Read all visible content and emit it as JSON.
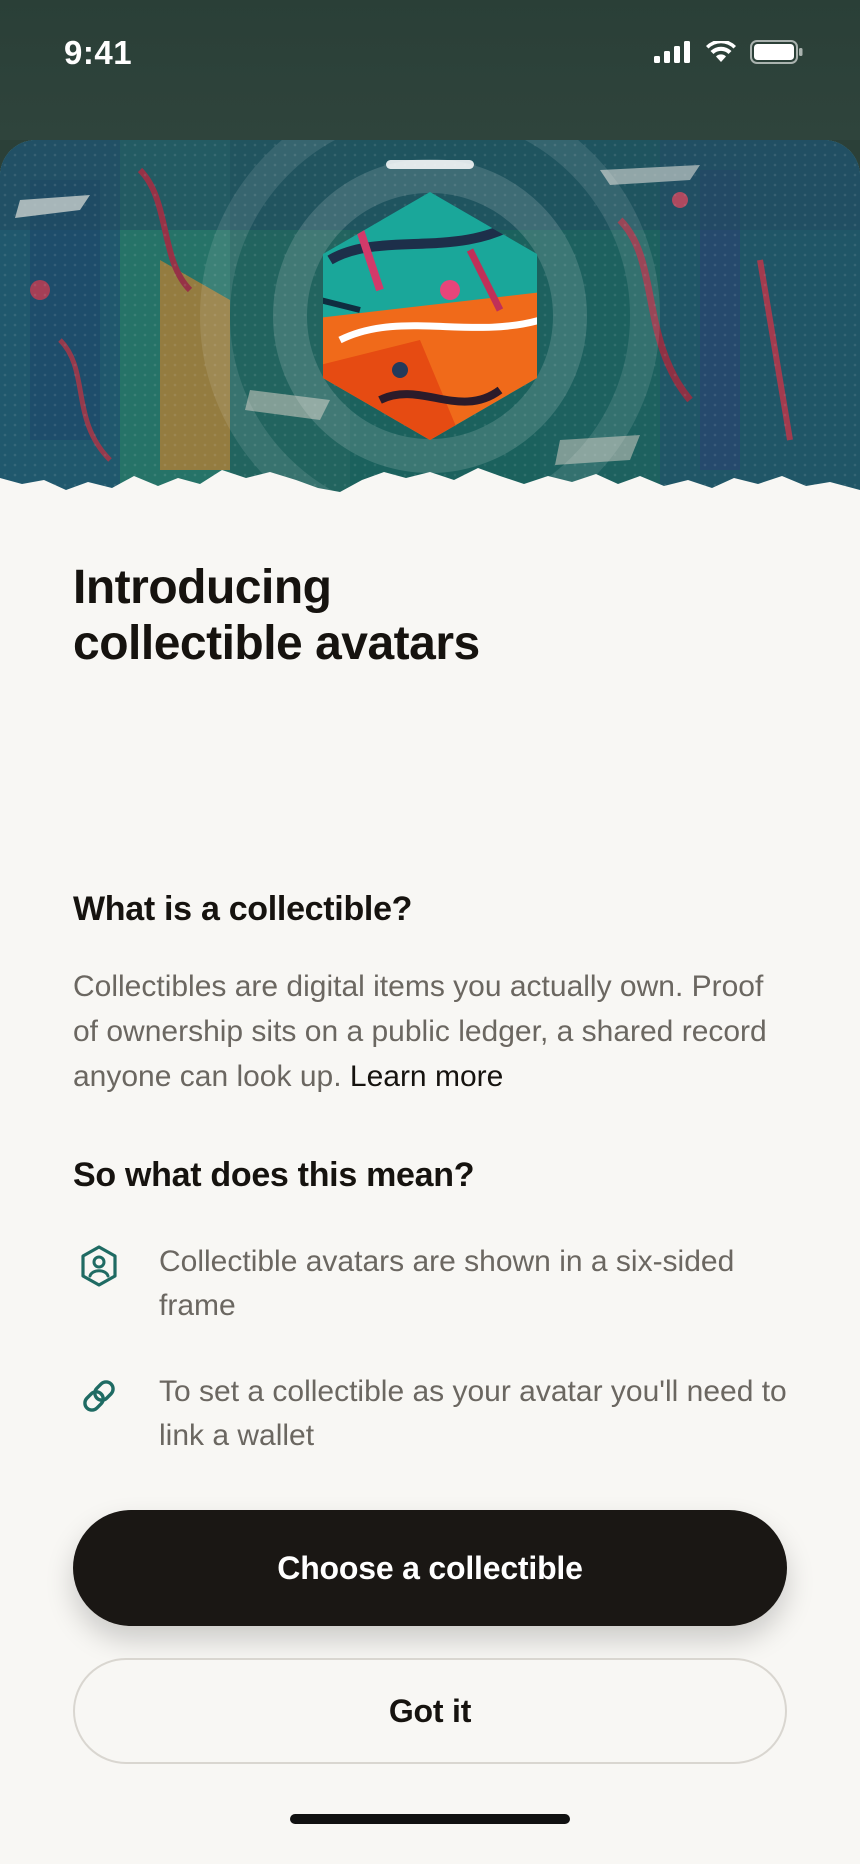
{
  "status": {
    "time": "9:41"
  },
  "sheet": {
    "title_line1": "Introducing",
    "title_line2": "collectible avatars",
    "section1_heading": "What is a collectible?",
    "section1_text": "Collectibles are digital items you actually own. Proof of ownership sits on a public ledger, a shared record anyone can look up.",
    "learn_more": "Learn more",
    "section2_heading": "So what does this mean?",
    "items": [
      {
        "icon": "hexagon-person-icon",
        "text": "Collectible avatars are shown in a six-sided frame"
      },
      {
        "icon": "link-icon",
        "text": "To set a collectible as your avatar you'll need to link a wallet"
      }
    ]
  },
  "buttons": {
    "primary": "Choose a collectible",
    "secondary": "Got it"
  },
  "colors": {
    "accent_teal": "#1f6b63",
    "primary_button": "#1a1714",
    "status_bar": "#2b4038"
  }
}
